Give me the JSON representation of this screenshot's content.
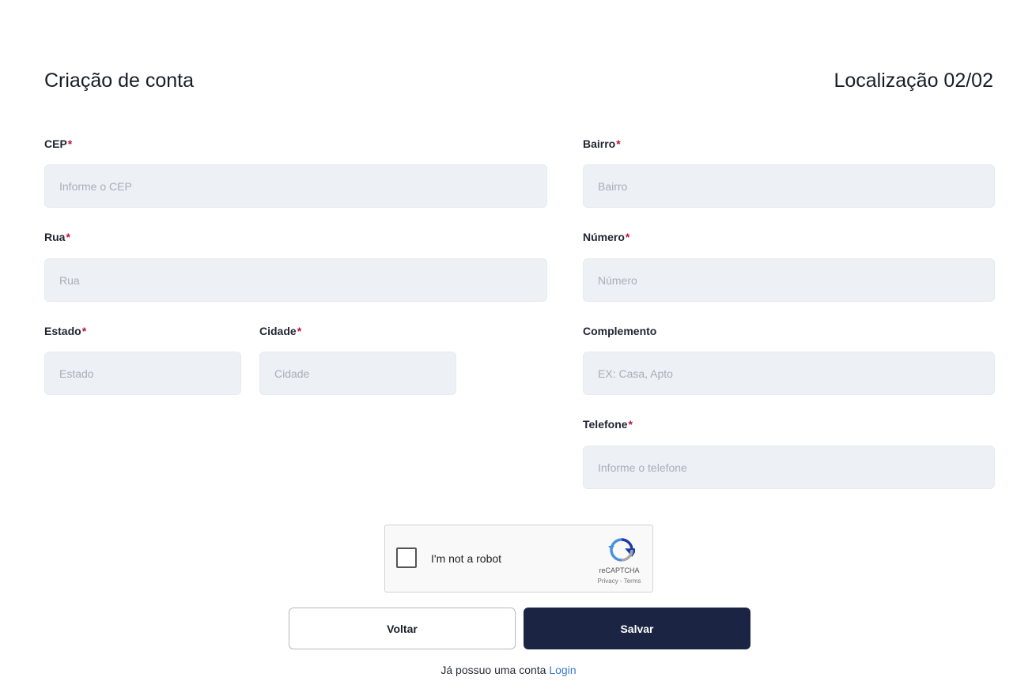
{
  "header": {
    "title": "Criação de conta",
    "step": "Localização 02/02"
  },
  "form": {
    "required_mark": "*",
    "cep": {
      "label": "CEP",
      "placeholder": "Informe o CEP",
      "value": ""
    },
    "rua": {
      "label": "Rua",
      "placeholder": "Rua",
      "value": ""
    },
    "estado": {
      "label": "Estado",
      "placeholder": "Estado",
      "value": ""
    },
    "cidade": {
      "label": "Cidade",
      "placeholder": "Cidade",
      "value": ""
    },
    "bairro": {
      "label": "Bairro",
      "placeholder": "Bairro",
      "value": ""
    },
    "numero": {
      "label": "Número",
      "placeholder": "Número",
      "value": ""
    },
    "complemento": {
      "label": "Complemento",
      "placeholder": "EX: Casa, Apto",
      "value": ""
    },
    "telefone": {
      "label": "Telefone",
      "placeholder": "Informe o telefone",
      "value": ""
    }
  },
  "captcha": {
    "label": "I'm not a robot",
    "brand": "reCAPTCHA",
    "links": "Privacy - Terms",
    "checked": false,
    "logo_icon": "recaptcha-icon"
  },
  "actions": {
    "back_label": "Voltar",
    "save_label": "Salvar"
  },
  "footer": {
    "text": "Já possuo uma conta",
    "link_label": "Login"
  },
  "colors": {
    "primary": "#1b2443",
    "required": "#c0112f",
    "link": "#3a7bd5",
    "input_bg": "#edf0f4"
  }
}
